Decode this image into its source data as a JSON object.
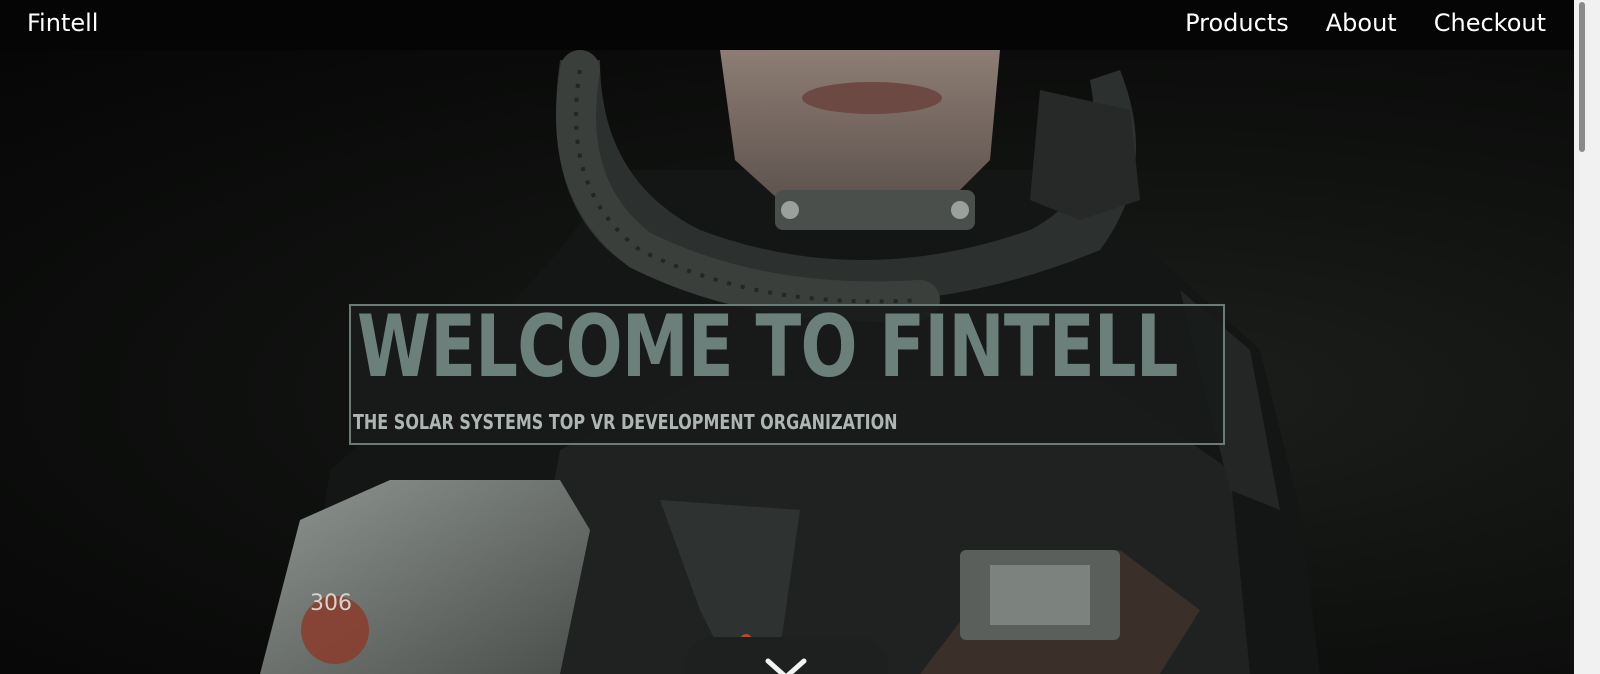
{
  "navbar": {
    "brand": "Fintell",
    "links": [
      "Products",
      "About",
      "Checkout"
    ]
  },
  "hero": {
    "title": "WELCOME TO FINTELL",
    "subtitle": "THE SOLAR SYSTEMS TOP VR DEVELOPMENT ORGANIZATION",
    "background": "dark scene with a figure in a futuristic armored spacesuit and helmet",
    "scroll_icon": "chevron-down-icon"
  },
  "colors": {
    "navbar_bg": "#050505",
    "title_color": "#6b7f7b",
    "box_border": "#6b7c78",
    "box_bg": "#181b1a",
    "subtitle_color": "#aeb6b3"
  }
}
